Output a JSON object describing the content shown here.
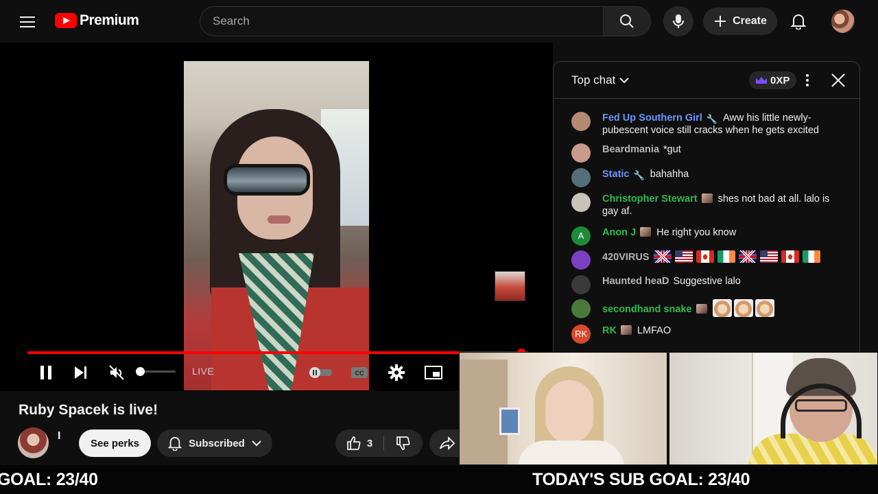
{
  "header": {
    "logo_text": "Premium",
    "search_placeholder": "Search",
    "create_label": "Create"
  },
  "player": {
    "live_label": "LIVE",
    "progress_fraction": 0.99
  },
  "video": {
    "title": "Ruby Spacek is live!",
    "channel_name": "I",
    "see_perks_label": "See perks",
    "subscribed_label": "Subscribed",
    "like_count": "3"
  },
  "chat": {
    "mode_label": "Top chat",
    "xp_label": "0XP",
    "messages": [
      {
        "author": "Fed Up Southern Girl",
        "text": "Aww his little newly-pubescent voice still cracks when he gets excited",
        "color": "#6e96ff",
        "avatar_color": "#b58a73"
      },
      {
        "author": "Beardmania",
        "text": "*gut",
        "color": "#b5b5b5",
        "avatar_color": "#c99a8a"
      },
      {
        "author": "Static",
        "text": "bahahha",
        "color": "#6e96ff",
        "avatar_color": "#546e7a"
      },
      {
        "author": "Christopher Stewart",
        "text": "shes not bad at all. lalo is gay af.",
        "color": "#2fba4e",
        "avatar_color": "#c9c2b8"
      },
      {
        "author": "Anon J",
        "text": "He right you know",
        "color": "#2fba4e",
        "avatar_initial": "A",
        "avatar_color": "#1e8a3a"
      },
      {
        "author": "420VIRUS",
        "text": "",
        "color": "#b5b5b5",
        "avatar_color": "#7b3fc4",
        "flags": [
          "uk",
          "us",
          "ca",
          "ie",
          "uk",
          "us",
          "ca",
          "ie"
        ]
      },
      {
        "author": "Haunted heaD",
        "text": "Suggestive lalo",
        "color": "#b5b5b5",
        "avatar_color": "#3a3a3a"
      },
      {
        "author": "secondhand snake",
        "text": "",
        "color": "#2fba4e",
        "avatar_color": "#4a7a3a",
        "emotes": 3
      },
      {
        "author": "RK",
        "text": "LMFAO",
        "color": "#2fba4e",
        "avatar_initial": "RK",
        "avatar_color": "#d84a2a"
      }
    ]
  },
  "ticker": {
    "text_left": "GOAL: 23/40",
    "text_right": "TODAY'S SUB GOAL: 23/40"
  },
  "colors": {
    "brand_red": "#ff0000",
    "background": "#0f0f0f",
    "chat_blue_name": "#6e96ff",
    "chat_green_name": "#2fba4e"
  }
}
